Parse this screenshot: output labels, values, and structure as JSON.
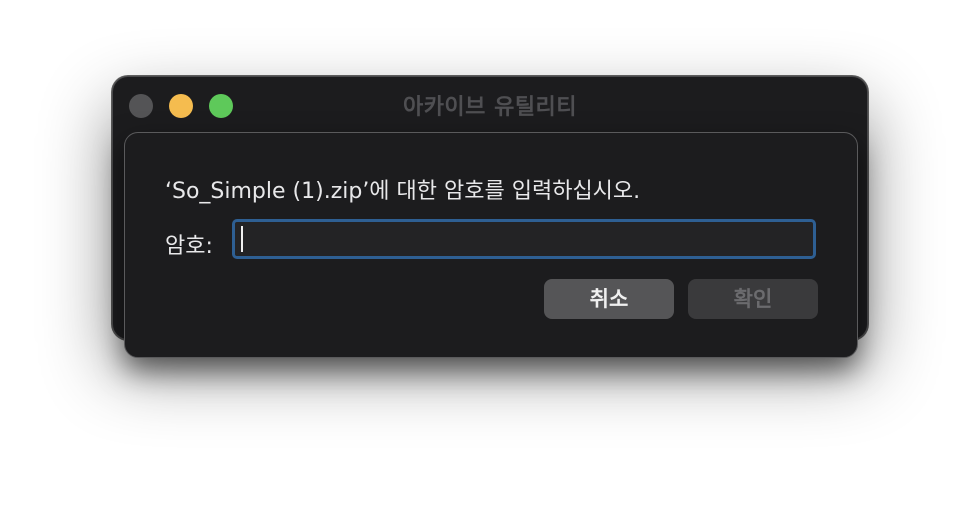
{
  "window": {
    "title": "아카이브 유틸리티"
  },
  "dialog": {
    "message": "‘So_Simple (1).zip’에 대한 암호를 입력하십시오.",
    "password_label": "암호:",
    "password_value": "",
    "cancel_label": "취소",
    "ok_label": "확인"
  },
  "colors": {
    "close": "#545456",
    "minimize": "#f5bc4f",
    "maximize": "#5ec95a",
    "focus_ring": "#2e5f93",
    "window_bg": "#1c1c1e"
  }
}
